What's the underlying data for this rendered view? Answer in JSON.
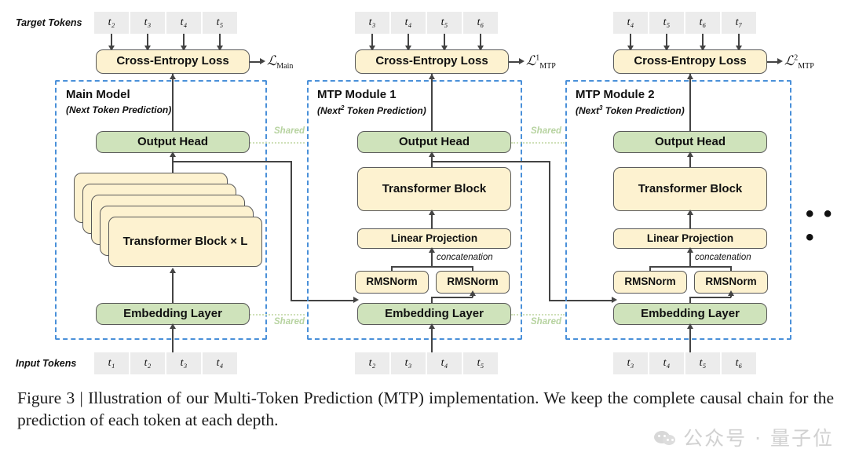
{
  "figure": {
    "caption": "Figure 3 | Illustration of our Multi-Token Prediction (MTP) implementation.  We keep the complete causal chain for the prediction of each token at each depth.",
    "ellipsis": "• • •",
    "watermark": "公众号 · 量子位"
  },
  "rows": {
    "target_tokens_label": "Target Tokens",
    "input_tokens_label": "Input Tokens"
  },
  "shared_labels": {
    "output_head_left": "Shared",
    "output_head_right": "Shared",
    "embedding_left": "Shared",
    "embedding_right": "Shared"
  },
  "columns": [
    {
      "id": "main-model",
      "title": "Main Model",
      "subtitle_pre": "(Next",
      "subtitle_sup": "",
      "subtitle_post": " Token Prediction)",
      "target_tokens": [
        "t₂",
        "t₃",
        "t₄",
        "t₅"
      ],
      "input_tokens": [
        "t₁",
        "t₂",
        "t₃",
        "t₄"
      ],
      "loss_box": "Cross-Entropy Loss",
      "loss_symbol_base": "ℒ",
      "loss_symbol_sub": "Main",
      "loss_symbol_sup": "",
      "output_head": "Output Head",
      "trunk": "Transformer Block × L",
      "embedding": "Embedding Layer"
    },
    {
      "id": "mtp-module-1",
      "title": "MTP Module 1",
      "subtitle_pre": "(Next",
      "subtitle_sup": "2",
      "subtitle_post": " Token Prediction)",
      "target_tokens": [
        "t₃",
        "t₄",
        "t₅",
        "t₆"
      ],
      "input_tokens": [
        "t₂",
        "t₃",
        "t₄",
        "t₅"
      ],
      "loss_box": "Cross-Entropy Loss",
      "loss_symbol_base": "ℒ",
      "loss_symbol_sub": "MTP",
      "loss_symbol_sup": "1",
      "output_head": "Output Head",
      "transformer": "Transformer Block",
      "linear": "Linear Projection",
      "rmsnorm_left": "RMSNorm",
      "rmsnorm_right": "RMSNorm",
      "concat": "concatenation",
      "embedding": "Embedding Layer"
    },
    {
      "id": "mtp-module-2",
      "title": "MTP Module 2",
      "subtitle_pre": "(Next",
      "subtitle_sup": "3",
      "subtitle_post": " Token Prediction)",
      "target_tokens": [
        "t₄",
        "t₅",
        "t₆",
        "t₇"
      ],
      "input_tokens": [
        "t₃",
        "t₄",
        "t₅",
        "t₆"
      ],
      "loss_box": "Cross-Entropy Loss",
      "loss_symbol_base": "ℒ",
      "loss_symbol_sub": "MTP",
      "loss_symbol_sup": "2",
      "output_head": "Output Head",
      "transformer": "Transformer Block",
      "linear": "Linear Projection",
      "rmsnorm_left": "RMSNorm",
      "rmsnorm_right": "RMSNorm",
      "concat": "concatenation",
      "embedding": "Embedding Layer"
    }
  ],
  "colors": {
    "token_chip": "#ececec",
    "yellow_box": "#fdf2d0",
    "green_box": "#cfe3bb",
    "module_border": "#4a90d9",
    "box_border": "#595959",
    "shared_dot": "#cfe0b8",
    "line": "#444444"
  }
}
